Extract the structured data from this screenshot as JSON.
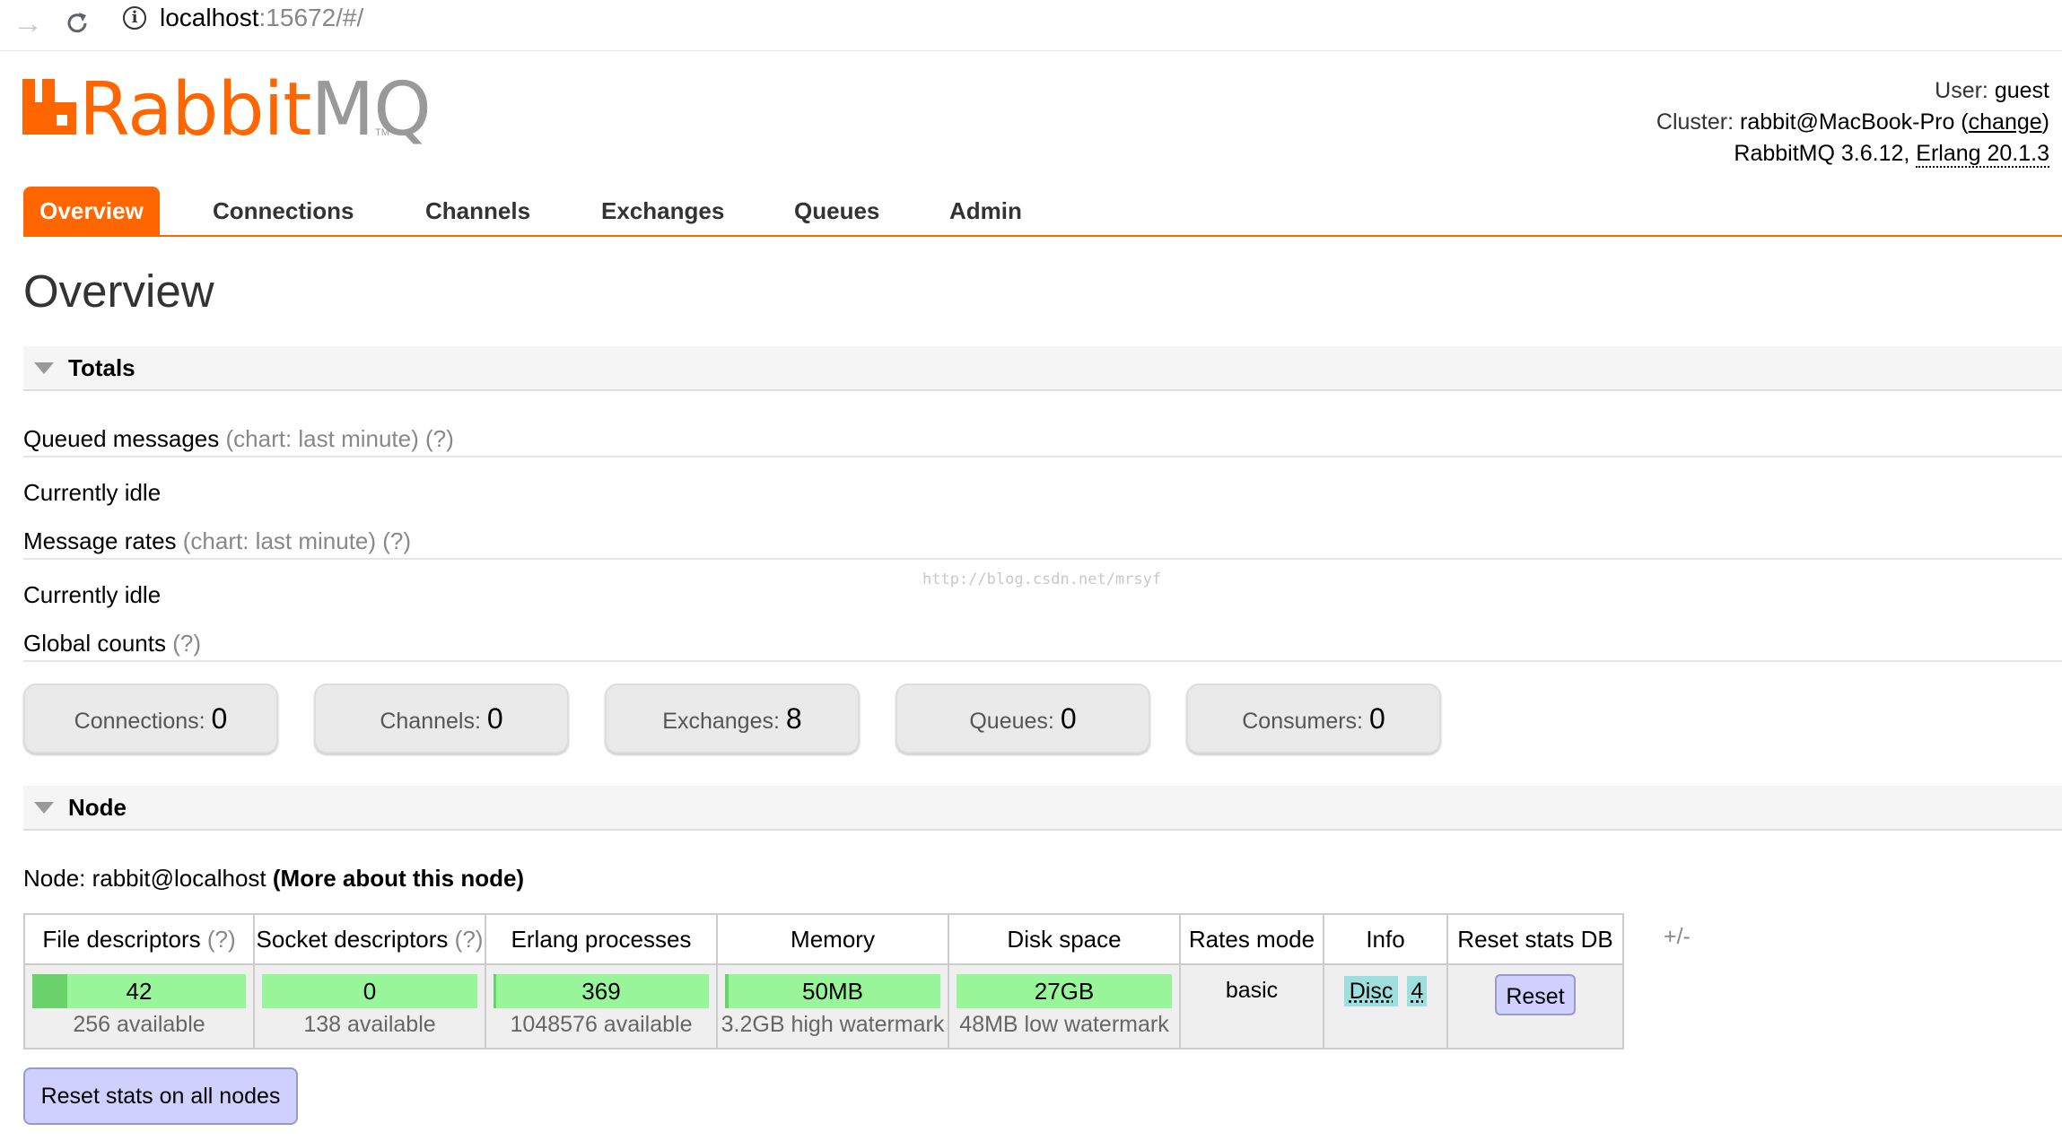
{
  "browser": {
    "url_host": "localhost",
    "url_rest": ":15672/#/",
    "back_icon": "arrow-right-icon",
    "reload_icon": "reload-icon"
  },
  "header": {
    "logo_rabbit": "Rabbit",
    "logo_mq": "MQ",
    "logo_tm": "TM",
    "user_label": "User:",
    "user_value": "guest",
    "cluster_label": "Cluster:",
    "cluster_value": "rabbit@MacBook-Pro",
    "cluster_change": "change",
    "version": "RabbitMQ 3.6.12,",
    "erlang": "Erlang 20.1.3"
  },
  "tabs": [
    "Overview",
    "Connections",
    "Channels",
    "Exchanges",
    "Queues",
    "Admin"
  ],
  "page_title": "Overview",
  "totals": {
    "section_title": "Totals",
    "queued_label": "Queued messages",
    "queued_hint": "(chart: last minute) (?)",
    "queued_state": "Currently idle",
    "rates_label": "Message rates",
    "rates_hint": "(chart: last minute) (?)",
    "rates_state": "Currently idle",
    "global_label": "Global counts",
    "global_hint": "(?)"
  },
  "watermark": "http://blog.csdn.net/mrsyf",
  "counts": [
    {
      "label": "Connections:",
      "value": "0"
    },
    {
      "label": "Channels:",
      "value": "0"
    },
    {
      "label": "Exchanges:",
      "value": "8"
    },
    {
      "label": "Queues:",
      "value": "0"
    },
    {
      "label": "Consumers:",
      "value": "0"
    }
  ],
  "node": {
    "section_title": "Node",
    "node_label": "Node: rabbit@localhost",
    "more_link": "(More about this node)",
    "headers": {
      "file_desc": "File descriptors",
      "file_desc_q": "(?)",
      "socket_desc": "Socket descriptors",
      "socket_desc_q": "(?)",
      "erlang_proc": "Erlang processes",
      "memory": "Memory",
      "disk": "Disk space",
      "rates_mode": "Rates mode",
      "info": "Info",
      "reset_db": "Reset stats DB"
    },
    "plus_minus": "+/-",
    "row": {
      "file_desc_value": "42",
      "file_desc_sub": "256 available",
      "file_desc_fraction": 0.164,
      "socket_value": "0",
      "socket_sub": "138 available",
      "socket_fraction": 0,
      "erlang_value": "369",
      "erlang_sub": "1048576 available",
      "erlang_fraction": 0.0004,
      "memory_value": "50MB",
      "memory_sub": "3.2GB high watermark",
      "memory_fraction": 0.016,
      "disk_value": "27GB",
      "disk_sub": "48MB low watermark",
      "rates_mode": "basic",
      "info_disc": "Disc",
      "info_num": "4",
      "reset_label": "Reset"
    },
    "reset_all_label": "Reset stats on all nodes"
  }
}
